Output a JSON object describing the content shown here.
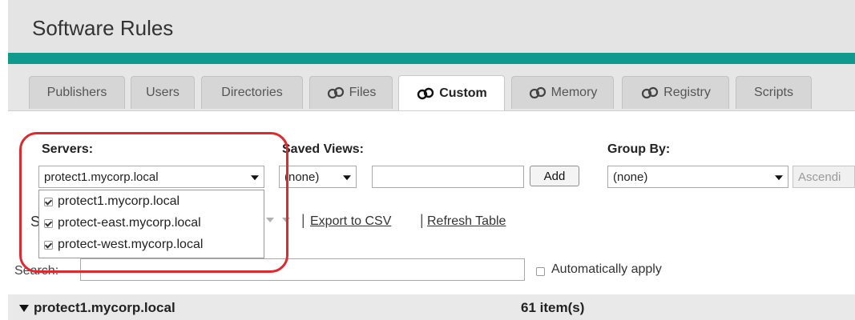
{
  "page": {
    "title": "Software Rules"
  },
  "tabs": [
    {
      "label": "Publishers",
      "icon": ""
    },
    {
      "label": "Users",
      "icon": ""
    },
    {
      "label": "Directories",
      "icon": ""
    },
    {
      "label": "Files",
      "icon": "link-icon"
    },
    {
      "label": "Custom",
      "icon": "link-icon",
      "active": true
    },
    {
      "label": "Memory",
      "icon": "link-icon"
    },
    {
      "label": "Registry",
      "icon": "link-icon"
    },
    {
      "label": "Scripts",
      "icon": ""
    }
  ],
  "servers": {
    "label": "Servers:",
    "selected": "protect1.mycorp.local",
    "options": [
      {
        "label": "protect1.mycorp.local",
        "checked": true
      },
      {
        "label": "protect-east.mycorp.local",
        "checked": true
      },
      {
        "label": "protect-west.mycorp.local",
        "checked": true
      }
    ]
  },
  "saved_views": {
    "label": "Saved Views:",
    "selected": "(none)",
    "name_value": "",
    "add_label": "Add"
  },
  "group_by": {
    "label": "Group By:",
    "selected": "(none)",
    "order_selected": "Ascendi"
  },
  "actions": {
    "partial_letter": "S",
    "export_label": "Export to CSV",
    "refresh_label": "Refresh Table"
  },
  "search": {
    "label": "Search:",
    "value": "",
    "auto_apply_label": "Automatically apply",
    "auto_apply_checked": false
  },
  "group_header": {
    "name": "protect1.mycorp.local",
    "count": "61 item(s)"
  },
  "colors": {
    "accent": "#0f9a8d",
    "highlight": "#e0282f"
  }
}
